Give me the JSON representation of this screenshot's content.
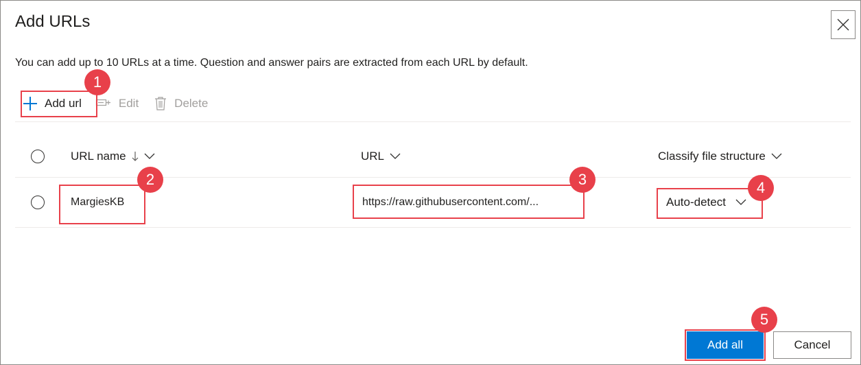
{
  "dialog": {
    "title": "Add URLs",
    "description": "You can add up to 10 URLs at a time. Question and answer pairs are extracted from each URL by default."
  },
  "toolbar": {
    "add_label": "Add url",
    "edit_label": "Edit",
    "delete_label": "Delete"
  },
  "table": {
    "columns": [
      {
        "label": "URL name",
        "sort_icon": "arrow-down-icon",
        "menu_icon": "chevron-down-icon"
      },
      {
        "label": "URL",
        "menu_icon": "chevron-down-icon"
      },
      {
        "label": "Classify file structure",
        "menu_icon": "chevron-down-icon"
      }
    ],
    "rows": [
      {
        "name": "MargiesKB",
        "url": "https://raw.githubusercontent.com/...",
        "classify": "Auto-detect"
      }
    ]
  },
  "footer": {
    "primary_label": "Add all",
    "secondary_label": "Cancel"
  },
  "annotations": [
    "1",
    "2",
    "3",
    "4",
    "5"
  ],
  "colors": {
    "accent": "#0078d4",
    "annotation": "#e8404a",
    "disabled": "#a19f9d",
    "divider": "#edebe9"
  }
}
